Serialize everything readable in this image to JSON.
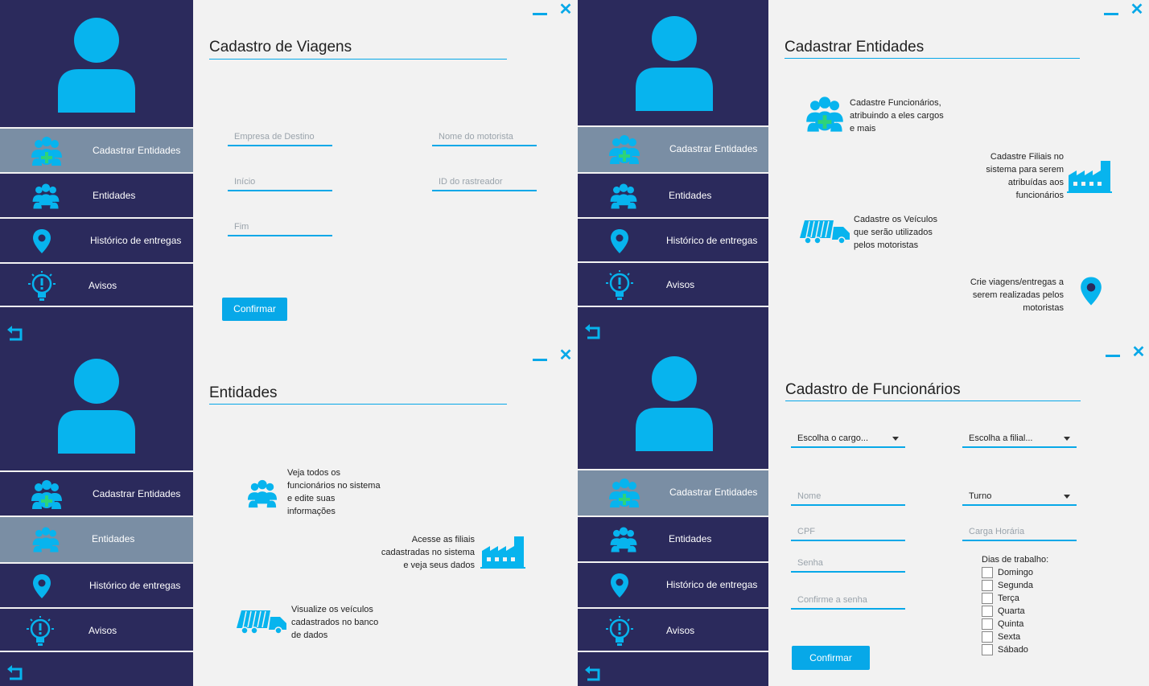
{
  "menu": {
    "cadastrar": "Cadastrar Entidades",
    "entidades": "Entidades",
    "historico": "Histórico de entregas",
    "avisos": "Avisos"
  },
  "viagens": {
    "title": "Cadastro de Viagens",
    "empresa": "Empresa de Destino",
    "motorista": "Nome do motorista",
    "inicio": "Início",
    "rastreador": "ID do rastreador",
    "fim": "Fim",
    "confirm": "Confirmar"
  },
  "cadastrar": {
    "title": "Cadastrar Entidades",
    "funcionarios": [
      "Cadastre Funcionários,",
      "atribuindo a eles cargos",
      "e mais"
    ],
    "filiais": [
      "Cadastre Filiais no",
      "sistema para serem",
      "atribuídas aos",
      "funcionários"
    ],
    "veiculos": [
      "Cadastre os Veículos",
      "que serão utilizados",
      "pelos motoristas"
    ],
    "viagens": [
      "Crie viagens/entregas a",
      "serem realizadas pelos",
      "motoristas"
    ]
  },
  "entidades": {
    "title": "Entidades",
    "funcionarios": [
      "Veja todos os",
      "funcionários no sistema",
      "e edite suas",
      "informações"
    ],
    "filiais": [
      "Acesse as filiais",
      "cadastradas no sistema",
      "e veja seus dados"
    ],
    "veiculos": [
      "Visualize os veículos",
      "cadastrados no banco",
      "de dados"
    ]
  },
  "funcionarios": {
    "title": "Cadastro de Funcionários",
    "cargo": "Escolha o cargo...",
    "filial": "Escolha a filial...",
    "nome": "Nome",
    "turno": "Turno",
    "cpf": "CPF",
    "carga": "Carga Horária",
    "senha": "Senha",
    "confirme": "Confirme a senha",
    "dias_label": "Dias de trabalho:",
    "dias": [
      "Domingo",
      "Segunda",
      "Terça",
      "Quarta",
      "Quinta",
      "Sexta",
      "Sábado"
    ],
    "confirm": "Confirmar"
  },
  "colors": {
    "sidebar": "#2b2a5c",
    "accent": "#07a8e8",
    "active": "#7a8ea4",
    "background": "#f2f2f2"
  },
  "icons": [
    "user-avatar-icon",
    "add-group-icon",
    "group-icon",
    "location-pin-icon",
    "alert-bulb-icon",
    "back-arrow-icon",
    "minimize-icon",
    "close-icon",
    "factory-icon",
    "truck-icon"
  ]
}
